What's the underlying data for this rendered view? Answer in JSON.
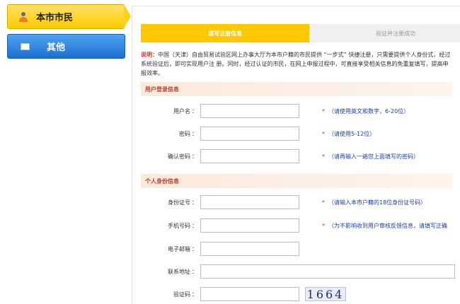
{
  "sidebar": {
    "items": [
      {
        "label": "本市市民",
        "icon": "person-icon"
      },
      {
        "label": "其他",
        "icon": "document-icon"
      }
    ]
  },
  "steps": {
    "step1": "填写注册信息",
    "step2": "验证并注册成功"
  },
  "note": {
    "key": "说明：",
    "text": "中国（天津）自由贸易试验区网上办事大厅为本市户籍的市民提供 “一步式” 快捷注册，只需要提供个人身份式，经过系统验证后，即可实现用户注 册。同时，经过认证的市民，在网上申报过程中，可直接享受相关信息的免重复填写，提高申报效率。"
  },
  "sections": {
    "login": "用户登录信息",
    "identity": "个人身份信息"
  },
  "fields": {
    "username": {
      "label": "用户名",
      "hint": "（请使用英文和数字，6-20位）"
    },
    "password": {
      "label": "密码",
      "hint": "（请使用5-12位）"
    },
    "confirm": {
      "label": "确认密码",
      "hint": "（请再输入一遍您上面填写的密码）"
    },
    "idcard": {
      "label": "身份证号",
      "hint": "（请输入本市户籍的18位身份证号码）"
    },
    "mobile": {
      "label": "手机号码",
      "hint": "（为不影响收到用户审核反馈信息，请填写正确"
    },
    "email": {
      "label": "电子邮箱"
    },
    "address": {
      "label": "联系地址"
    },
    "captcha": {
      "label": "验证码",
      "image_text": "1664"
    }
  },
  "colon": "：",
  "star": "*",
  "colors": {
    "step_active": "#ffc800",
    "sidebar_active": "#ffcc00",
    "sidebar_other": "#1b6fd0",
    "hint_text": "#1a3faf",
    "required_star": "#d9381e",
    "section_title": "#c0392b"
  }
}
